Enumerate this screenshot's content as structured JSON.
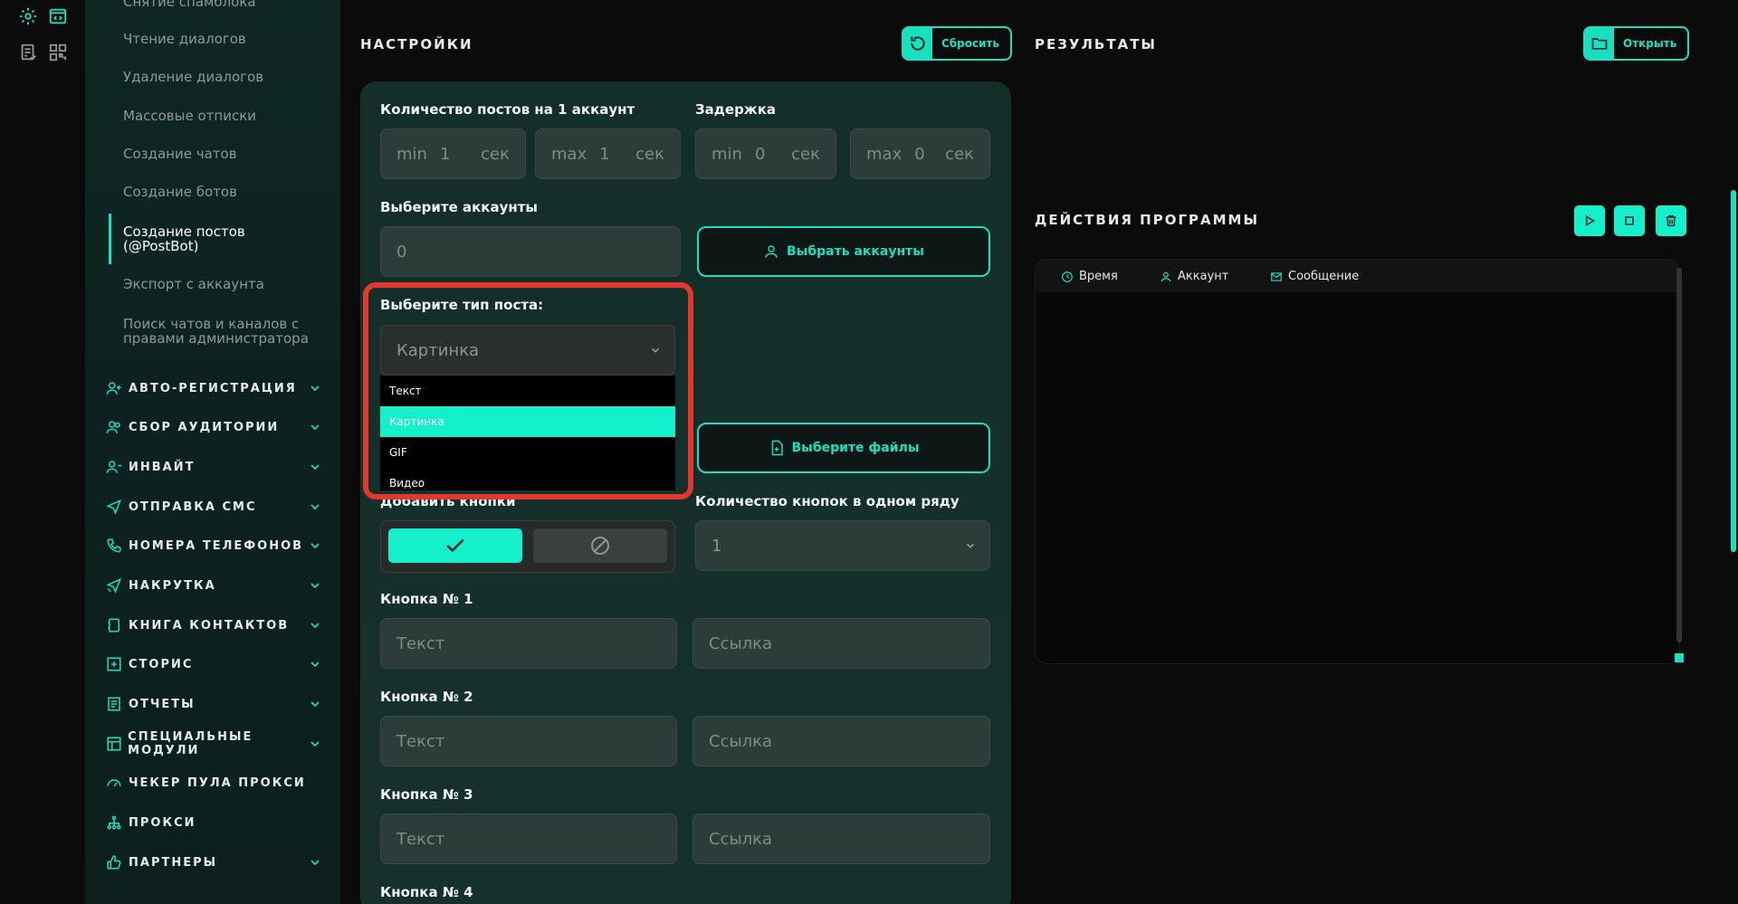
{
  "rail": {
    "icons": [
      "gear-icon",
      "code-window-icon",
      "report-check-icon",
      "qr-grid-icon"
    ]
  },
  "sidebar": {
    "sub_items": [
      "Снятие спамблока",
      "Чтение диалогов",
      "Удаление диалогов",
      "Массовые отписки",
      "Создание чатов",
      "Создание ботов",
      "Создание постов\n(@PostBot)",
      "Экспорт с аккаунта",
      "Поиск чатов и каналов с\nправами администратора"
    ],
    "active_index": 6,
    "sections": [
      {
        "label": "АВТО-РЕГИСТРАЦИЯ",
        "icon": "user-plus-icon",
        "chevron": true
      },
      {
        "label": "СБОР АУДИТОРИИ",
        "icon": "users-icon",
        "chevron": true
      },
      {
        "label": "ИНВАЙТ",
        "icon": "user-add-icon",
        "chevron": true
      },
      {
        "label": "ОТПРАВКА СМС",
        "icon": "send-icon",
        "chevron": true
      },
      {
        "label": "НОМЕРА ТЕЛЕФОНОВ",
        "icon": "phone-icon",
        "chevron": true
      },
      {
        "label": "НАКРУТКА",
        "icon": "send-boost-icon",
        "chevron": true
      },
      {
        "label": "КНИГА КОНТАКТОВ",
        "icon": "contact-book-icon",
        "chevron": true
      },
      {
        "label": "СТОРИС",
        "icon": "plus-square-icon",
        "chevron": true
      },
      {
        "label": "ОТЧЕТЫ",
        "icon": "report-icon",
        "chevron": true
      },
      {
        "label": "СПЕЦИАЛЬНЫЕ МОДУЛИ",
        "icon": "module-icon",
        "chevron": true
      },
      {
        "label": "ЧЕКЕР ПУЛА ПРОКСИ",
        "icon": "gauge-icon",
        "chevron": false
      },
      {
        "label": "ПРОКСИ",
        "icon": "network-icon",
        "chevron": false
      },
      {
        "label": "ПАРТНЕРЫ",
        "icon": "thumbs-up-icon",
        "chevron": true
      }
    ]
  },
  "settings": {
    "title": "НАСТРОЙКИ",
    "reset_label": "Сбросить",
    "posts_label": "Количество постов на 1 аккаунт",
    "posts_min": {
      "pre": "min",
      "val": "1",
      "suf": "сек"
    },
    "posts_max": {
      "pre": "max",
      "val": "1",
      "suf": "сек"
    },
    "delay_label": "Задержка",
    "delay_min": {
      "pre": "min",
      "val": "0",
      "suf": "сек"
    },
    "delay_max": {
      "pre": "max",
      "val": "0",
      "suf": "сек"
    },
    "accounts_label": "Выберите аккаунты",
    "accounts_value": "0",
    "choose_accounts_label": "Выбрать аккаунты",
    "post_type_label": "Выберите тип поста:",
    "post_type_value": "Картинка",
    "post_type_options": [
      "Текст",
      "Картинка",
      "GIF",
      "Видео"
    ],
    "post_type_selected_index": 1,
    "files_label_hidden": "Выберите файлы",
    "choose_files_label": "Выберите файлы",
    "add_buttons_label": "Добавить кнопки",
    "buttons_per_row_label": "Количество кнопок в одном ряду",
    "buttons_per_row_value": "1",
    "button_blocks": [
      {
        "label": "Кнопка № 1",
        "text_ph": "Текст",
        "link_ph": "Ссылка"
      },
      {
        "label": "Кнопка № 2",
        "text_ph": "Текст",
        "link_ph": "Ссылка"
      },
      {
        "label": "Кнопка № 3",
        "text_ph": "Текст",
        "link_ph": "Ссылка"
      },
      {
        "label": "Кнопка № 4"
      }
    ]
  },
  "results": {
    "title": "РЕЗУЛЬТАТЫ",
    "open_label": "Открыть",
    "actions_title": "ДЕЙСТВИЯ ПРОГРАММЫ",
    "columns": [
      {
        "label": "Время",
        "icon": "clock-icon"
      },
      {
        "label": "Аккаунт",
        "icon": "user-icon"
      },
      {
        "label": "Сообщение",
        "icon": "mail-icon"
      }
    ]
  },
  "colors": {
    "accent": "#14f0cc",
    "highlight": "#e3362c",
    "panel": "#16302c"
  }
}
